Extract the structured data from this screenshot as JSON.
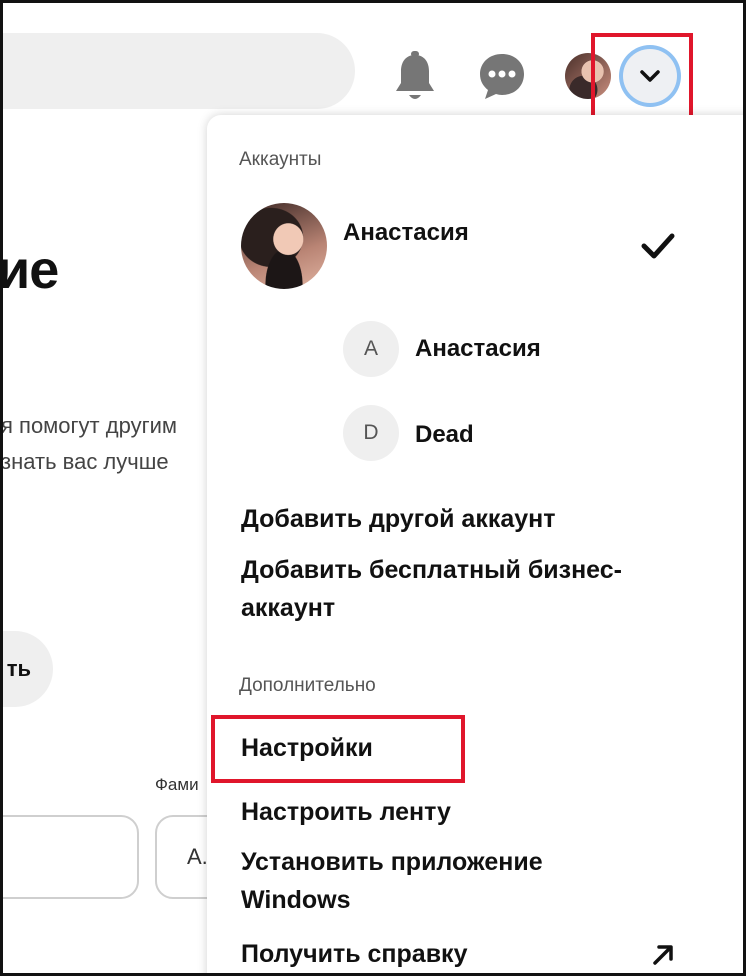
{
  "header": {
    "icons": [
      "bell-icon",
      "chat-icon",
      "avatar",
      "chevron-down-icon"
    ]
  },
  "background": {
    "heading_fragment": "ие",
    "text_line1": "я помогут другим",
    "text_line2": "знать вас лучше",
    "button_fragment": "ть",
    "field_label_fragment": "Фами",
    "input_fragment": "А."
  },
  "dropdown": {
    "accounts_label": "Аккаунты",
    "current_account": {
      "name": "Анастасия",
      "selected": true
    },
    "other_accounts": [
      {
        "initial": "A",
        "name": "Анастасия"
      },
      {
        "initial": "D",
        "name": "Dead"
      }
    ],
    "add_account": "Добавить другой аккаунт",
    "add_business_line1": "Добавить бесплатный бизнес-",
    "add_business_line2": "аккаунт",
    "more_label": "Дополнительно",
    "settings": "Настройки",
    "customize_feed": "Настроить ленту",
    "install_app_line1": "Установить приложение",
    "install_app_line2": "Windows",
    "get_help": "Получить справку"
  },
  "colors": {
    "highlight": "#e0162b",
    "focus_ring": "#8fc1f2"
  }
}
